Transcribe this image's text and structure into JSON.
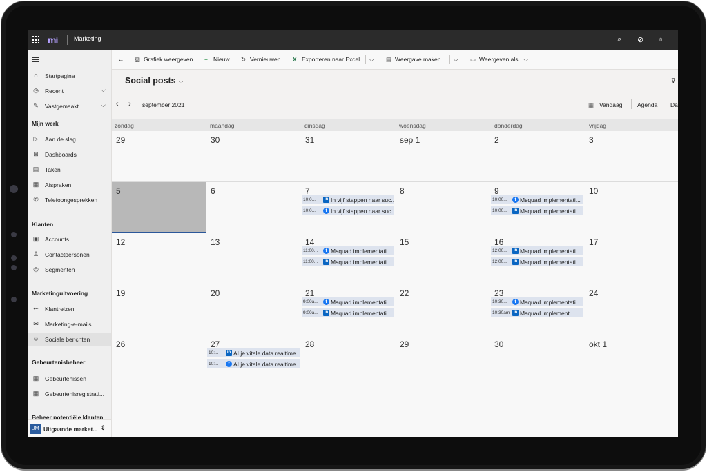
{
  "app": {
    "name": "Marketing",
    "logo_text": "mi"
  },
  "topbar": {
    "icons": [
      "search-icon",
      "task-check-icon",
      "lightbulb-icon"
    ]
  },
  "sidebar": {
    "items": [
      {
        "label": "Startpagina",
        "icon": "home-icon"
      },
      {
        "label": "Recent",
        "icon": "clock-icon"
      },
      {
        "label": "Vastgemaakt",
        "icon": "pin-icon"
      }
    ],
    "groups": [
      {
        "title": "Mijn werk",
        "items": [
          {
            "label": "Aan de slag",
            "icon": "play-icon"
          },
          {
            "label": "Dashboards",
            "icon": "dashboard-icon"
          },
          {
            "label": "Taken",
            "icon": "task-icon"
          },
          {
            "label": "Afspraken",
            "icon": "calendar-icon"
          },
          {
            "label": "Telefoongesprekken",
            "icon": "phone-icon"
          }
        ]
      },
      {
        "title": "Klanten",
        "items": [
          {
            "label": "Accounts",
            "icon": "building-icon"
          },
          {
            "label": "Contactpersonen",
            "icon": "person-icon"
          },
          {
            "label": "Segmenten",
            "icon": "segment-icon"
          }
        ]
      },
      {
        "title": "Marketinguitvoering",
        "items": [
          {
            "label": "Klantreizen",
            "icon": "journey-icon"
          },
          {
            "label": "Marketing-e-mails",
            "icon": "mail-icon"
          },
          {
            "label": "Sociale berichten",
            "icon": "social-icon"
          }
        ]
      },
      {
        "title": "Gebeurtenisbeheer",
        "items": [
          {
            "label": "Gebeurtenissen",
            "icon": "calendar-icon"
          },
          {
            "label": "Gebeurtenisregistrati...",
            "icon": "calendar-icon"
          }
        ]
      },
      {
        "title": "Beheer potentiële klanten",
        "items": []
      }
    ],
    "area": {
      "initials": "UM",
      "label": "Uitgaande market..."
    }
  },
  "command_bar": {
    "back": "←",
    "chart": "Grafiek weergeven",
    "new": "Nieuw",
    "refresh": "Vernieuwen",
    "excel": "Exporteren naar Excel",
    "create_view": "Weergave maken",
    "show_as": "Weergeven als"
  },
  "view": {
    "title": "Social posts",
    "month": "september 2021",
    "today": "Vandaag",
    "agenda": "Agenda",
    "day": "Da"
  },
  "calendar": {
    "weekdays": [
      "zondag",
      "maandag",
      "dinsdag",
      "woensdag",
      "donderdag",
      "vrijdag"
    ],
    "weeks": [
      [
        "29",
        "30",
        "31",
        "sep 1",
        "2",
        "3"
      ],
      [
        "5",
        "6",
        "7",
        "8",
        "9",
        "10"
      ],
      [
        "12",
        "13",
        "14",
        "15",
        "16",
        "17"
      ],
      [
        "19",
        "20",
        "21",
        "22",
        "23",
        "24"
      ],
      [
        "26",
        "27",
        "28",
        "29",
        "30",
        "okt 1"
      ]
    ],
    "selected_day": "5",
    "events": [
      {
        "week": 1,
        "day": 2,
        "slot": 0,
        "time": "10:0...",
        "network": "linkedin",
        "title": "In vijf stappen naar suc..."
      },
      {
        "week": 1,
        "day": 2,
        "slot": 1,
        "time": "10:0...",
        "network": "facebook",
        "title": "In vijf stappen naar suc..."
      },
      {
        "week": 1,
        "day": 4,
        "slot": 0,
        "time": "10:00...",
        "network": "facebook",
        "title": "Msquad implementati..."
      },
      {
        "week": 1,
        "day": 4,
        "slot": 1,
        "time": "10:00...",
        "network": "linkedin",
        "title": "Msquad implementati..."
      },
      {
        "week": 2,
        "day": 2,
        "slot": 0,
        "time": "11:00...",
        "network": "facebook",
        "title": "Msquad implementati..."
      },
      {
        "week": 2,
        "day": 2,
        "slot": 1,
        "time": "11:00...",
        "network": "linkedin",
        "title": "Msquad implementati..."
      },
      {
        "week": 2,
        "day": 4,
        "slot": 0,
        "time": "12:00...",
        "network": "linkedin",
        "title": "Msquad implementati..."
      },
      {
        "week": 2,
        "day": 4,
        "slot": 1,
        "time": "12:00...",
        "network": "linkedin",
        "title": "Msquad implementati..."
      },
      {
        "week": 3,
        "day": 2,
        "slot": 0,
        "time": "9:00a...",
        "network": "facebook",
        "title": "Msquad implementati..."
      },
      {
        "week": 3,
        "day": 2,
        "slot": 1,
        "time": "9:00a...",
        "network": "linkedin",
        "title": "Msquad implementati..."
      },
      {
        "week": 3,
        "day": 4,
        "slot": 0,
        "time": "10:30...",
        "network": "facebook",
        "title": "Msquad implementati..."
      },
      {
        "week": 3,
        "day": 4,
        "slot": 1,
        "time": "10:30am",
        "network": "linkedin",
        "title": "Msquad implement..."
      },
      {
        "week": 4,
        "day": 1,
        "slot": 0,
        "time": "10:...",
        "network": "linkedin",
        "title": "AI je vitale data realtime..."
      },
      {
        "week": 4,
        "day": 1,
        "slot": 1,
        "time": "10:...",
        "network": "facebook",
        "title": "AI je vitale data realtime..."
      }
    ]
  },
  "colors": {
    "topbar": "#2b2b2b",
    "accent": "#2b579a",
    "event_bg": "#dde3ee",
    "linkedin": "#0a66c2",
    "facebook": "#1877f2"
  }
}
